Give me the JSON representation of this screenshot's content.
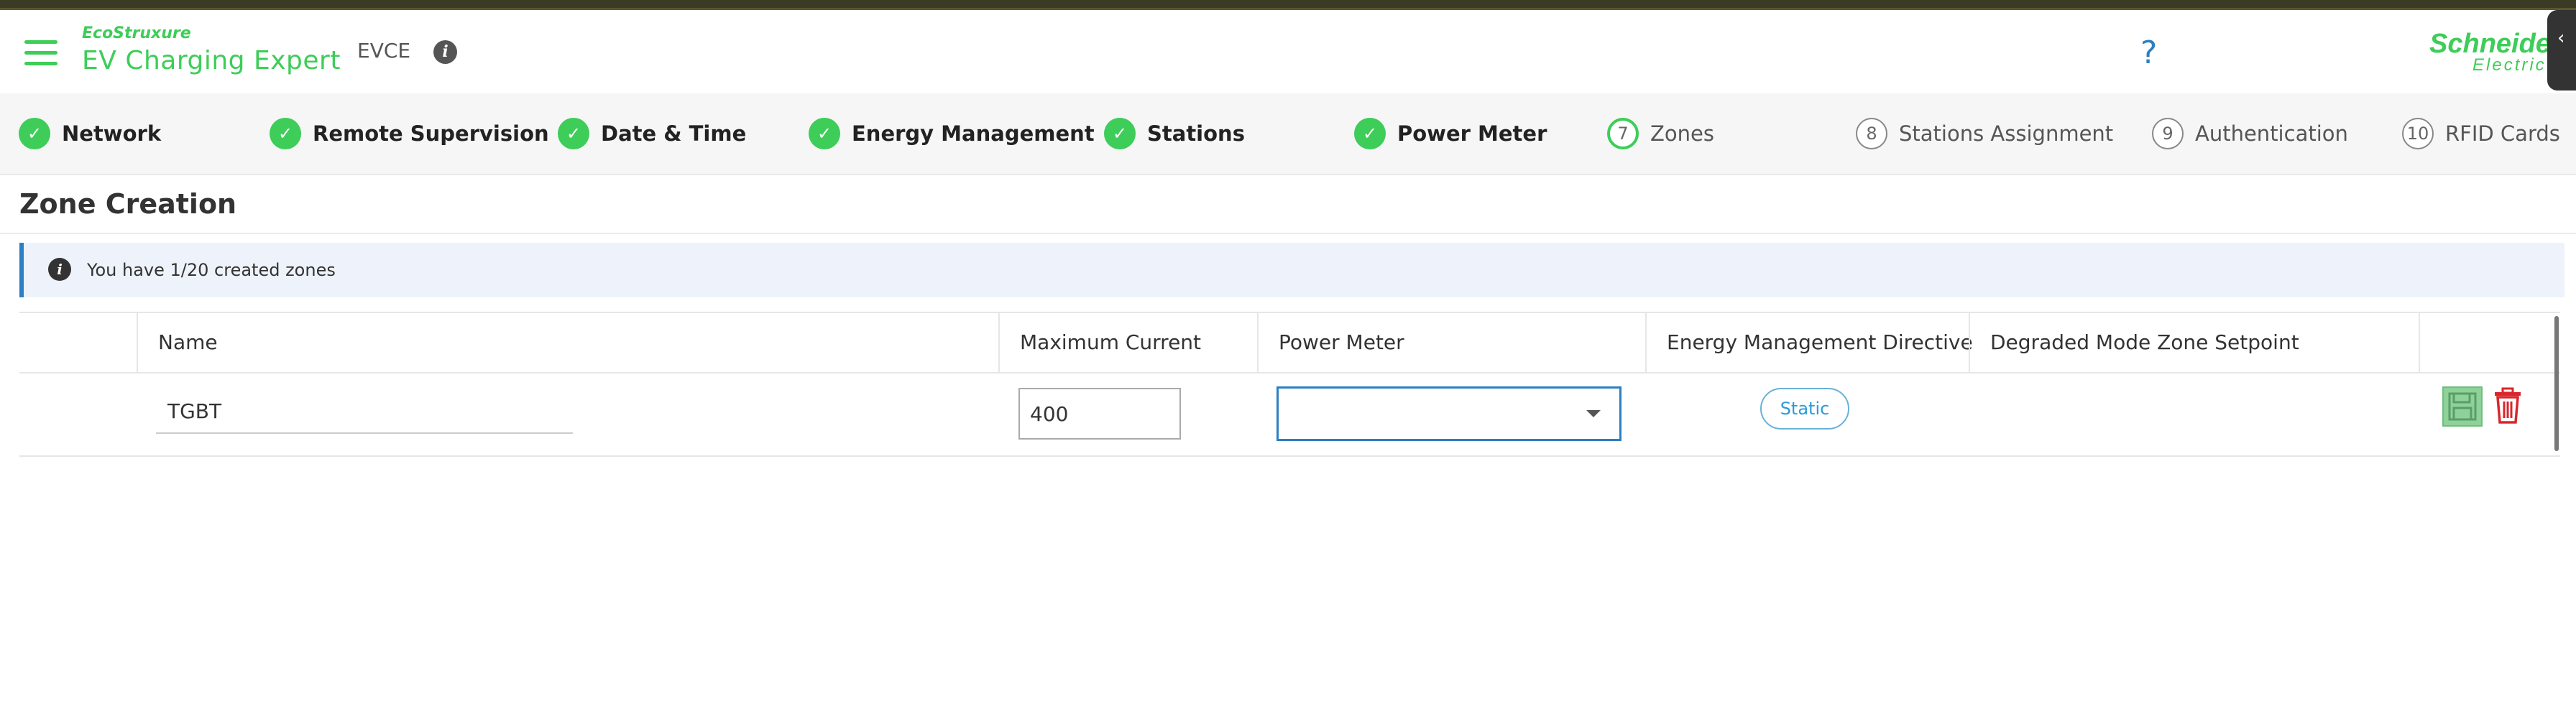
{
  "header": {
    "brand_small": "EcoStruxure",
    "app_title": "EV Charging Expert",
    "device": "EVCE",
    "info_glyph": "i",
    "help_glyph": "?",
    "logo_line1": "Schneider",
    "logo_line2": "Electric",
    "side_tab_glyph": "‹"
  },
  "stepper": {
    "check_glyph": "✓",
    "steps": [
      {
        "num": "1",
        "label": "Network",
        "state": "done"
      },
      {
        "num": "2",
        "label": "Remote Supervision",
        "state": "done"
      },
      {
        "num": "3",
        "label": "Date & Time",
        "state": "done"
      },
      {
        "num": "4",
        "label": "Energy Management",
        "state": "done"
      },
      {
        "num": "5",
        "label": "Stations",
        "state": "done"
      },
      {
        "num": "6",
        "label": "Power Meter",
        "state": "done"
      },
      {
        "num": "7",
        "label": "Zones",
        "state": "current"
      },
      {
        "num": "8",
        "label": "Stations Assignment",
        "state": "pending"
      },
      {
        "num": "9",
        "label": "Authentication",
        "state": "pending"
      },
      {
        "num": "10",
        "label": "RFID Cards",
        "state": "pending"
      }
    ]
  },
  "section": {
    "title": "Zone Creation",
    "alert_glyph": "i",
    "alert_text": "You have 1/20 created zones"
  },
  "table": {
    "columns": {
      "name": "Name",
      "max_current": "Maximum Current",
      "power_meter": "Power Meter",
      "emd": "Energy Management Directive",
      "degraded": "Degraded Mode Zone Setpoint"
    },
    "row": {
      "name": "TGBT",
      "max_current": "400",
      "power_meter": "",
      "directive": "Static"
    }
  },
  "colors": {
    "accent_green": "#3dcd58",
    "link_blue": "#2b7fc2",
    "delete_red": "#d9262b"
  }
}
